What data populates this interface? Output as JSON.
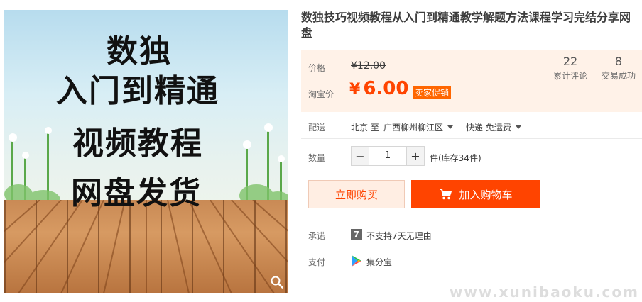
{
  "product": {
    "image_lines": [
      "数独",
      "入门到精通",
      "视频教程",
      "网盘发货"
    ],
    "title": "数独技巧视频教程从入门到精通教学解题方法课程学习完结分享网盘"
  },
  "price": {
    "price_label": "价格",
    "original": "¥12.00",
    "taobao_label": "淘宝价",
    "sale_symbol": "¥",
    "sale_amount": "6.00",
    "promo_badge": "卖家促销",
    "reviews_count": "22",
    "reviews_label": "累计评论",
    "sales_count": "8",
    "sales_label": "交易成功"
  },
  "delivery": {
    "label": "配送",
    "origin": "北京 至",
    "destination": "广西柳州柳江区",
    "shipping": "快递 免运费"
  },
  "quantity": {
    "label": "数量",
    "minus": "−",
    "value": "1",
    "plus": "+",
    "stock_text": "件(库存34件)"
  },
  "actions": {
    "buy_now": "立即购买",
    "add_to_cart": "加入购物车"
  },
  "promise": {
    "label": "承诺",
    "badge": "7",
    "text": "不支持7天无理由"
  },
  "payment": {
    "label": "支付",
    "method": "集分宝"
  },
  "watermark": "www.xunibaoku.com",
  "colors": {
    "accent": "#ff4400",
    "price_panel_bg": "#fff2e8",
    "promo_badge_bg": "#ff6600"
  },
  "icons": {
    "zoom": "magnifier-icon",
    "cart": "shopping-cart-icon",
    "dropdown": "caret-down-icon",
    "payment": "jifenbao-play-icon"
  }
}
